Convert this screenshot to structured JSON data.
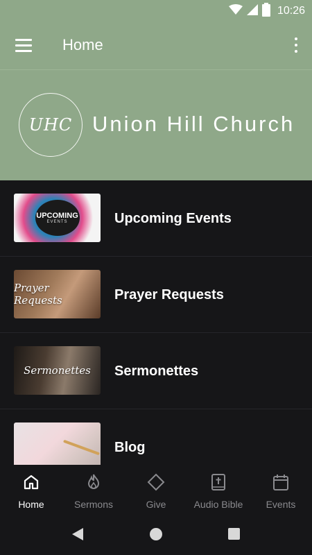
{
  "status_bar": {
    "time": "10:26",
    "icons": [
      "wifi-icon",
      "cell-signal-icon",
      "battery-icon"
    ]
  },
  "app_bar": {
    "title": "Home",
    "menu_icon": "hamburger-menu-icon",
    "overflow_icon": "more-vert-icon"
  },
  "banner": {
    "logo_text": "UHC",
    "church_name": "Union Hill Church"
  },
  "list": {
    "items": [
      {
        "label": "Upcoming Events",
        "thumb_title": "UPCOMING",
        "thumb_subtitle": "EVENTS"
      },
      {
        "label": "Prayer Requests",
        "thumb_title": "Prayer Requests"
      },
      {
        "label": "Sermonettes",
        "thumb_title": "Sermonettes"
      },
      {
        "label": "Blog"
      }
    ]
  },
  "bottom_nav": {
    "items": [
      {
        "label": "Home",
        "icon": "home-icon",
        "active": true
      },
      {
        "label": "Sermons",
        "icon": "flame-icon",
        "active": false
      },
      {
        "label": "Give",
        "icon": "diamond-icon",
        "active": false
      },
      {
        "label": "Audio Bible",
        "icon": "bible-icon",
        "active": false
      },
      {
        "label": "Events",
        "icon": "calendar-icon",
        "active": false
      }
    ]
  },
  "colors": {
    "brand_green": "#8FA889",
    "background": "#161618",
    "nav_inactive": "#8a8a8e",
    "nav_active": "#ffffff"
  }
}
